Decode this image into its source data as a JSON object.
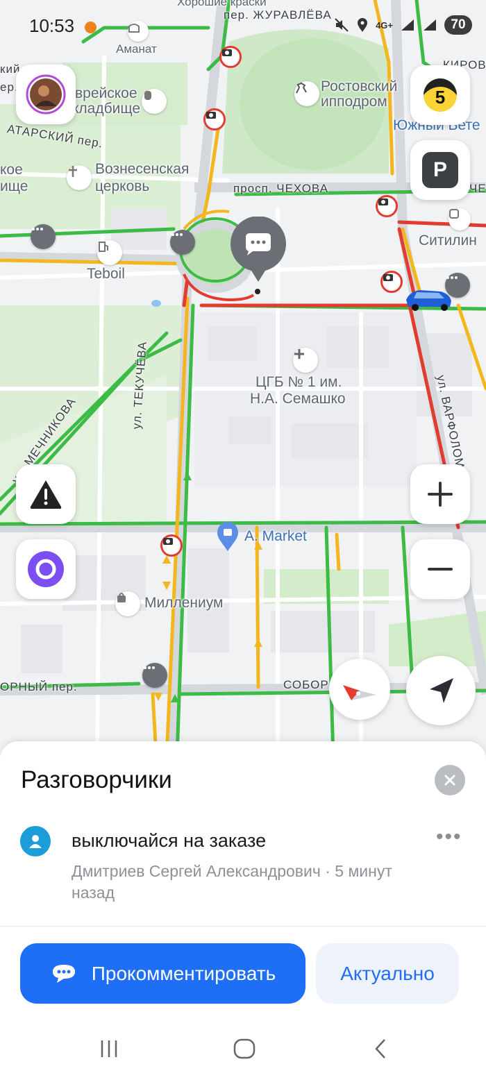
{
  "status_bar": {
    "time": "10:53",
    "network": "4G+",
    "battery": "70"
  },
  "map": {
    "places": {
      "amanat": "Аманат",
      "jewish_cemetery_1": "врейское",
      "jewish_cemetery_2": "кладбище",
      "hippodrome_1": "Ростовский",
      "hippodrome_2": "ипподром",
      "south_vet": "Южный Вете",
      "church_1": "Вознесенская",
      "church_2": "церковь",
      "left_1": "кое",
      "left_2": "ище",
      "teboil": "Teboil",
      "citilink": "Ситилин",
      "hospital_1": "ЦГБ № 1 им.",
      "hospital_2": "Н.А. Семашко",
      "market": "A. Market",
      "millenium": "Миллениум"
    },
    "streets": {
      "paints": "Хорошие краски",
      "zhuravleva": "пер. ЖУРАВЛЁВА",
      "kirova": "КИРОВ",
      "tatarsky": "АТАРСКИЙ пер.",
      "chekhova": "просп. ЧЕХОВА",
      "chekhova_right": "ЧЕ",
      "tekucheva": "ул. ТЕКУЧЁВА",
      "mechnikova": "ул. МЕЧНИКОВА",
      "varfolomeeva": "ул. ВАРФОЛОМЕЕ",
      "sobornyi_left": "ОРНЫЙ пер.",
      "sobornyi_right": "СОБОР",
      "left_edge_1": "кий",
      "left_edge_2": "ер."
    },
    "speed_limit": "5",
    "parking_label": "P"
  },
  "sheet": {
    "title": "Разговорчики",
    "comment_text": "выключайся на заказе",
    "author_meta": "Дмитриев Сергей Александрович · 5 минут назад",
    "more_label": "•••",
    "comment_button": "Прокомментировать",
    "actual_button": "Актуально"
  },
  "colors": {
    "accent": "#1f6ef6",
    "traffic_green": "#3dbb47",
    "traffic_yellow": "#f3b61f",
    "traffic_red": "#e23b2f"
  }
}
